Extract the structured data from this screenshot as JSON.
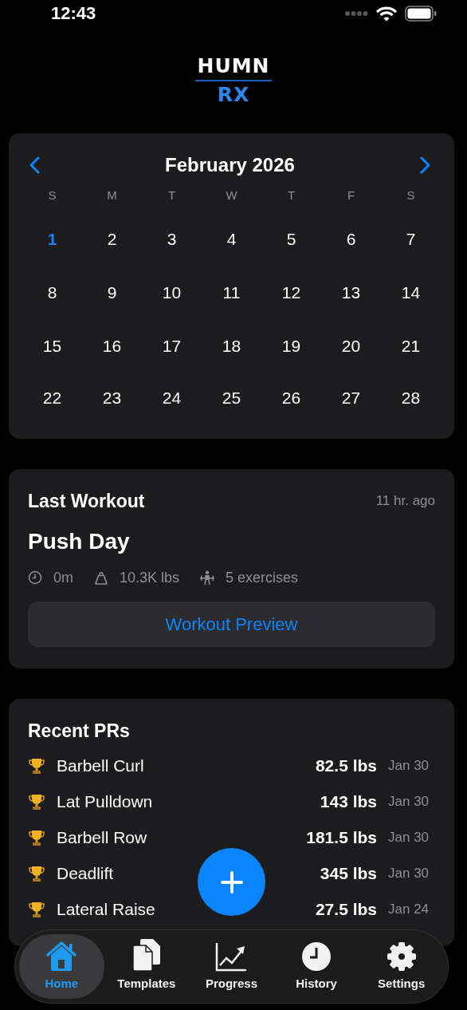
{
  "status_bar": {
    "time": "12:43"
  },
  "logo": {
    "line_1": "HUMN",
    "line_2": "RX"
  },
  "calendar": {
    "month": "February 2026",
    "weekdays": [
      "S",
      "M",
      "T",
      "W",
      "T",
      "F",
      "S"
    ],
    "days": [
      {
        "label": "1",
        "selected": true
      },
      {
        "label": "2",
        "selected": false
      },
      {
        "label": "3",
        "selected": false
      },
      {
        "label": "4",
        "selected": false
      },
      {
        "label": "5",
        "selected": false
      },
      {
        "label": "6",
        "selected": false
      },
      {
        "label": "7",
        "selected": false
      },
      {
        "label": "8",
        "selected": false
      },
      {
        "label": "9",
        "selected": false
      },
      {
        "label": "10",
        "selected": false
      },
      {
        "label": "11",
        "selected": false
      },
      {
        "label": "12",
        "selected": false
      },
      {
        "label": "13",
        "selected": false
      },
      {
        "label": "14",
        "selected": false
      },
      {
        "label": "15",
        "selected": false
      },
      {
        "label": "16",
        "selected": false
      },
      {
        "label": "17",
        "selected": false
      },
      {
        "label": "18",
        "selected": false
      },
      {
        "label": "19",
        "selected": false
      },
      {
        "label": "20",
        "selected": false
      },
      {
        "label": "21",
        "selected": false
      },
      {
        "label": "22",
        "selected": false
      },
      {
        "label": "23",
        "selected": false
      },
      {
        "label": "24",
        "selected": false
      },
      {
        "label": "25",
        "selected": false
      },
      {
        "label": "26",
        "selected": false
      },
      {
        "label": "27",
        "selected": false
      },
      {
        "label": "28",
        "selected": false
      }
    ]
  },
  "last_workout": {
    "heading": "Last Workout",
    "time_ago": "11 hr. ago",
    "name": "Push Day",
    "stats": [
      {
        "kind": "duration",
        "value": "0m"
      },
      {
        "kind": "volume",
        "value": "10.3K lbs"
      },
      {
        "kind": "exercises",
        "value": "5 exercises"
      }
    ],
    "button": "Workout Preview"
  },
  "recent_prs": {
    "heading": "Recent PRs",
    "items": [
      {
        "exercise": "Barbell Curl",
        "weight": "82.5 lbs",
        "date": "Jan 30"
      },
      {
        "exercise": "Lat Pulldown",
        "weight": "143 lbs",
        "date": "Jan 30"
      },
      {
        "exercise": "Barbell Row",
        "weight": "181.5 lbs",
        "date": "Jan 30"
      },
      {
        "exercise": "Deadlift",
        "weight": "345 lbs",
        "date": "Jan 30"
      },
      {
        "exercise": "Lateral Raise",
        "weight": "27.5 lbs",
        "date": "Jan 24"
      }
    ]
  },
  "tab_bar": [
    {
      "kind": "home",
      "label": "Home",
      "selected": true
    },
    {
      "kind": "templates",
      "label": "Templates",
      "selected": false
    },
    {
      "kind": "progress",
      "label": "Progress",
      "selected": false
    },
    {
      "kind": "history",
      "label": "History",
      "selected": false
    },
    {
      "kind": "settings",
      "label": "Settings",
      "selected": false
    }
  ]
}
